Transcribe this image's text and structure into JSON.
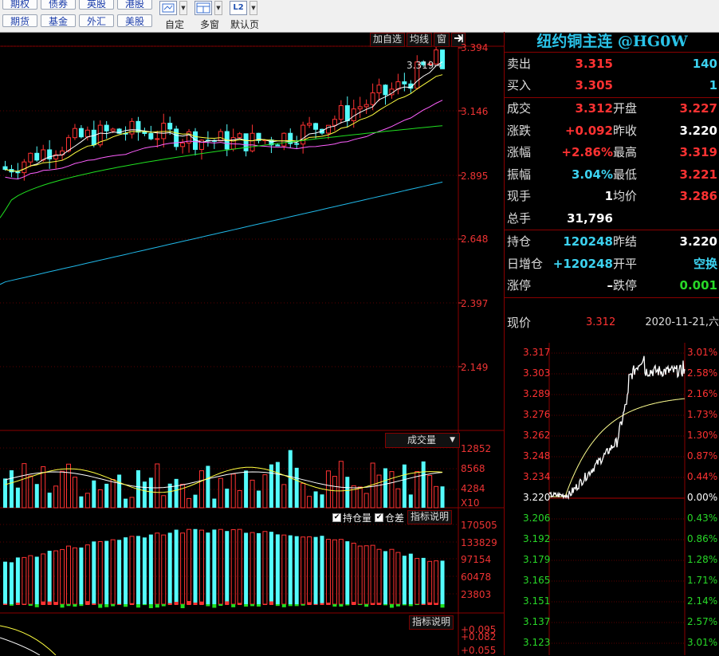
{
  "toolbar": {
    "row1": [
      "期权",
      "债券",
      "英股",
      "港股"
    ],
    "row2": [
      "期货",
      "基金",
      "外汇",
      "美股"
    ],
    "tools": [
      {
        "label": "自定",
        "icon": "custom-layout-icon"
      },
      {
        "label": "多窗",
        "icon": "multi-window-icon"
      },
      {
        "label": "默认页",
        "icon": "l2-icon",
        "icon_text": "L2"
      }
    ]
  },
  "chart": {
    "top_buttons": [
      "加自选",
      "均线",
      "窗"
    ],
    "price_axis": [
      "3.394",
      "3.146",
      "2.895",
      "2.648",
      "2.397",
      "2.149"
    ],
    "last_price_marker": "3.319",
    "volume_selector": "成交量",
    "volume_axis": [
      "12852",
      "8568",
      "4284",
      "X10"
    ],
    "oi_checkboxes": [
      {
        "label": "持仓量",
        "checked": true
      },
      {
        "label": "仓差",
        "checked": true
      }
    ],
    "indicator_help": "指标说明",
    "oi_axis": [
      "170505",
      "133829",
      "97154",
      "60478",
      "23803"
    ],
    "macd_help": "指标说明",
    "macd_axis": [
      "+0.095",
      "+0.082",
      "+0.055"
    ]
  },
  "chart_data": [
    {
      "type": "line",
      "title": "",
      "note": "daily candlestick chart with moving averages (visual reproduction)",
      "ylim": [
        2.1,
        3.42
      ],
      "y_ticks": [
        3.394,
        3.146,
        2.895,
        2.648,
        2.397,
        2.149
      ],
      "last_close": 3.319,
      "series": [
        {
          "color": "#ffffff"
        },
        {
          "color": "#ffff40"
        },
        {
          "color": "#ff60ff"
        },
        {
          "color": "#20e020"
        },
        {
          "color": "#20b8e8"
        }
      ]
    },
    {
      "type": "bar",
      "title": "成交量",
      "y_ticks": [
        12852,
        8568,
        4284
      ],
      "unit": "X10"
    },
    {
      "type": "bar",
      "title": "持仓量",
      "y_ticks": [
        170505,
        133829,
        97154,
        60478,
        23803
      ]
    },
    {
      "type": "line",
      "note": "intraday time-sharing chart",
      "price_axis": [
        "3.317",
        "3.303",
        "3.289",
        "3.276",
        "3.262",
        "3.248",
        "3.234",
        "3.220",
        "3.206",
        "3.192",
        "3.179",
        "3.165",
        "3.151",
        "3.137",
        "3.123"
      ],
      "pct_axis": [
        "3.01%",
        "2.58%",
        "2.16%",
        "1.73%",
        "1.30%",
        "0.87%",
        "0.44%",
        "0.00%",
        "0.43%",
        "0.86%",
        "1.28%",
        "1.71%",
        "2.14%",
        "2.57%",
        "3.01%"
      ],
      "ylim": [
        3.123,
        3.317
      ],
      "prev_close": 3.22
    }
  ],
  "quote": {
    "title": "纽约铜主连 @HG0W",
    "sell": {
      "label": "卖出",
      "price": "3.315",
      "vol": "140"
    },
    "buy": {
      "label": "买入",
      "price": "3.305",
      "vol": "1"
    },
    "rows": [
      {
        "l1": "成交",
        "v1": "3.312",
        "c1": "red",
        "l2": "开盘",
        "v2": "3.227",
        "c2": "red"
      },
      {
        "l1": "涨跌",
        "v1": "+0.092",
        "c1": "red",
        "l2": "昨收",
        "v2": "3.220",
        "c2": "white"
      },
      {
        "l1": "涨幅",
        "v1": "+2.86%",
        "c1": "red",
        "l2": "最高",
        "v2": "3.319",
        "c2": "red"
      },
      {
        "l1": "振幅",
        "v1": "3.04%",
        "c1": "cyan",
        "l2": "最低",
        "v2": "3.221",
        "c2": "red"
      },
      {
        "l1": "现手",
        "v1": "1",
        "c1": "white",
        "l2": "均价",
        "v2": "3.286",
        "c2": "red"
      }
    ],
    "total": {
      "label": "总手",
      "value": "31,796"
    },
    "rows2": [
      {
        "l1": "持仓",
        "v1": "120248",
        "c1": "cyan",
        "l2": "昨结",
        "v2": "3.220",
        "c2": "white"
      },
      {
        "l1": "日增仓",
        "v1": "+120248",
        "c1": "cyan",
        "l2": "开平",
        "v2": "空换",
        "c2": "cyan"
      },
      {
        "l1": "涨停",
        "v1": "–",
        "c1": "white",
        "l2": "跌停",
        "v2": "0.001",
        "c2": "green"
      }
    ],
    "now": {
      "label": "现价",
      "price": "3.312",
      "date": "2020-11-21,六"
    }
  },
  "colors": {
    "up": "#ff3232",
    "down": "#54fcfc",
    "frame": "#8a0000",
    "title": "#2ac3e8"
  }
}
